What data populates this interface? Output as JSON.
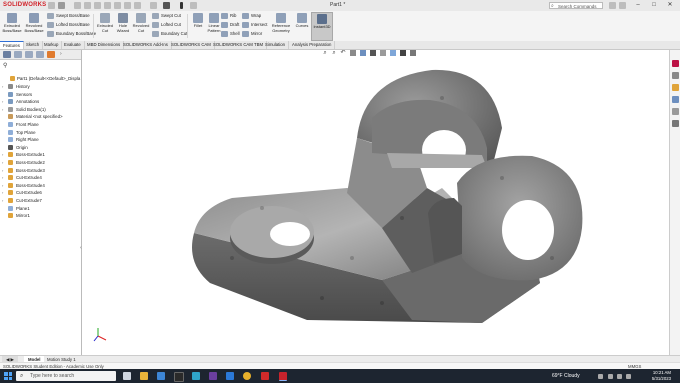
{
  "titlebar": {
    "app_name": "SOLIDWORKS",
    "doc_title": "Part1 *",
    "search_placeholder": "Search Commands",
    "minimize": "–",
    "maximize": "□",
    "close": "✕"
  },
  "ribbon": {
    "big_buttons": [
      {
        "label": "Extruded\nBoss/Base",
        "color": "#8a9bb5"
      },
      {
        "label": "Revolved\nBoss/Base",
        "color": "#8a9bb5"
      },
      {
        "label": "Extruded\nCut",
        "color": "#9aa7b8"
      },
      {
        "label": "Hole\nWizard",
        "color": "#7e8da3"
      },
      {
        "label": "Revolved\nCut",
        "color": "#9aa7b8"
      },
      {
        "label": "Fillet",
        "color": "#8fa0b8"
      },
      {
        "label": "Linear\nPattern",
        "color": "#8fa0b8"
      },
      {
        "label": "Reference\nGeometry",
        "color": "#8fa0b8"
      },
      {
        "label": "Curves",
        "color": "#8fa0b8"
      },
      {
        "label": "Instant3D",
        "color": "#5b6f8c"
      }
    ],
    "small_buttons": [
      {
        "label": "Swept Boss/Base"
      },
      {
        "label": "Lofted Boss/Base"
      },
      {
        "label": "Boundary Boss/Base"
      },
      {
        "label": "Swept Cut"
      },
      {
        "label": "Lofted Cut"
      },
      {
        "label": "Boundary Cut"
      },
      {
        "label": "Rib"
      },
      {
        "label": "Draft"
      },
      {
        "label": "Shell"
      },
      {
        "label": "Wrap"
      },
      {
        "label": "Intersect"
      },
      {
        "label": "Mirror"
      }
    ]
  },
  "tabs": [
    "Features",
    "Sketch",
    "Markup",
    "Evaluate",
    "MBD Dimensions",
    "SOLIDWORKS Add-Ins",
    "SOLIDWORKS CAM",
    "SOLIDWORKS CAM TBM",
    "Simulation",
    "Analysis Preparation"
  ],
  "feature_tree": {
    "root": "Part1  (Default<<Default>_Displa",
    "items": [
      {
        "label": "History",
        "expandable": true,
        "icon": "history-icon"
      },
      {
        "label": "Sensors",
        "expandable": false,
        "icon": "sensors-icon"
      },
      {
        "label": "Annotations",
        "expandable": true,
        "icon": "annotations-icon"
      },
      {
        "label": "Solid Bodies(1)",
        "expandable": true,
        "icon": "solid-bodies-icon"
      },
      {
        "label": "Material <not specified>",
        "expandable": false,
        "icon": "material-icon"
      },
      {
        "label": "Front Plane",
        "expandable": false,
        "icon": "plane-icon"
      },
      {
        "label": "Top Plane",
        "expandable": false,
        "icon": "plane-icon"
      },
      {
        "label": "Right Plane",
        "expandable": false,
        "icon": "plane-icon"
      },
      {
        "label": "Origin",
        "expandable": false,
        "icon": "origin-icon"
      },
      {
        "label": "Boss-Extrude1",
        "expandable": true,
        "icon": "boss-extrude-icon"
      },
      {
        "label": "Boss-Extrude2",
        "expandable": true,
        "icon": "boss-extrude-icon"
      },
      {
        "label": "Boss-Extrude3",
        "expandable": true,
        "icon": "boss-extrude-icon"
      },
      {
        "label": "Cut-Extrude4",
        "expandable": true,
        "icon": "cut-extrude-icon"
      },
      {
        "label": "Boss-Extrude4",
        "expandable": true,
        "icon": "boss-extrude-icon"
      },
      {
        "label": "Cut-Extrude6",
        "expandable": true,
        "icon": "cut-extrude-icon"
      },
      {
        "label": "Cut-Extrude7",
        "expandable": true,
        "icon": "cut-extrude-icon"
      },
      {
        "label": "Plane1",
        "expandable": false,
        "icon": "plane-icon"
      },
      {
        "label": "Mirror1",
        "expandable": false,
        "icon": "mirror-icon"
      }
    ]
  },
  "bottom_tabs": [
    "Model",
    "Motion Study 1"
  ],
  "status": {
    "text": "SOLIDWORKS Student Edition - Academic Use Only",
    "units": "MMGS"
  },
  "taskbar": {
    "search_placeholder": "Type here to search",
    "weather": "69°F  Cloudy",
    "time": "10:21 AM",
    "date": "5/31/2023"
  }
}
